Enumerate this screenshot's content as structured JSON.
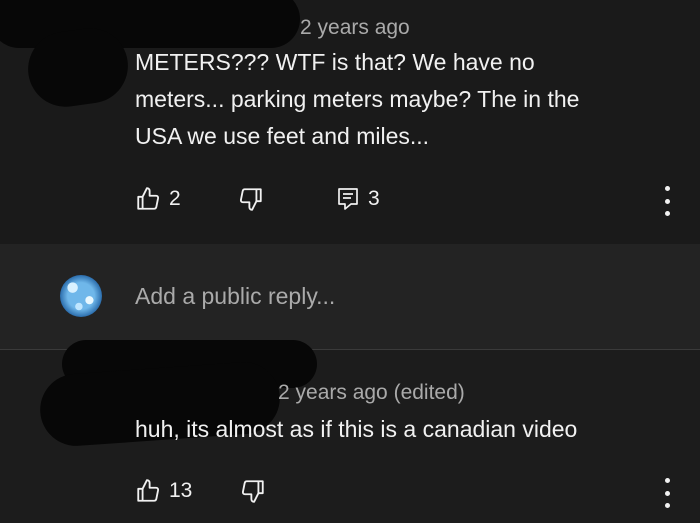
{
  "comment": {
    "timestamp": "2 years ago",
    "text_lines": [
      "METERS??? WTF is that?  We have no",
      "meters... parking meters maybe?  The in the",
      "USA we use feet and miles..."
    ],
    "like_count": "2",
    "reply_count": "3"
  },
  "reply_box": {
    "placeholder": "Add a public reply..."
  },
  "reply": {
    "timestamp": "2 years ago (edited)",
    "text": "huh, its almost as if this is a canadian video",
    "like_count": "13"
  },
  "icons": {
    "like": "thumbs-up-icon",
    "dislike": "thumbs-down-icon",
    "replies": "reply-comment-icon",
    "more": "more-vert-icon"
  }
}
